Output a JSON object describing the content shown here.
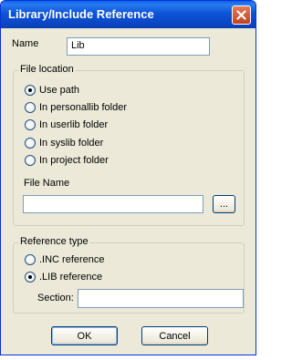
{
  "dialog": {
    "title": "Library/Include Reference",
    "close_icon": "close-icon"
  },
  "name_field": {
    "label": "Name",
    "value": "Lib"
  },
  "file_location": {
    "legend": "File location",
    "options": [
      {
        "label": "Use path",
        "selected": true
      },
      {
        "label": "In personallib folder",
        "selected": false
      },
      {
        "label": "In userlib folder",
        "selected": false
      },
      {
        "label": "In syslib folder",
        "selected": false
      },
      {
        "label": "In project folder",
        "selected": false
      }
    ],
    "file_name_label": "File Name",
    "file_name_value": "",
    "browse_label": "..."
  },
  "reference_type": {
    "legend": "Reference type",
    "options": [
      {
        "label": ".INC reference",
        "selected": false
      },
      {
        "label": ".LIB reference",
        "selected": true
      }
    ],
    "section_label": "Section:",
    "section_value": ""
  },
  "buttons": {
    "ok": "OK",
    "cancel": "Cancel"
  },
  "colors": {
    "titlebar": "#0a54d8",
    "dialog_bg": "#ece9d8",
    "close_button": "#c2411f"
  }
}
